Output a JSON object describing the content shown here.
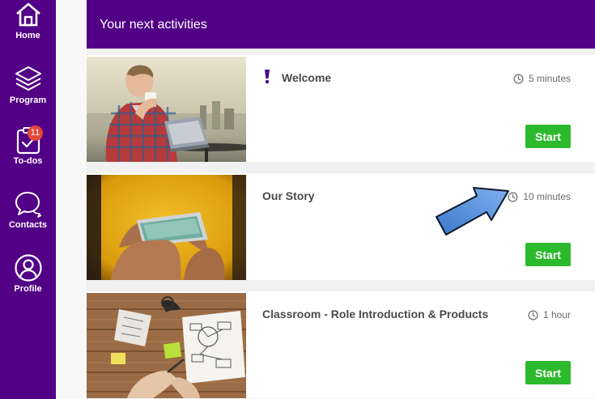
{
  "sidebar": {
    "items": [
      {
        "label": "Home",
        "icon": "home-icon"
      },
      {
        "label": "Program",
        "icon": "layers-icon"
      },
      {
        "label": "To-dos",
        "icon": "clipboard-check-icon",
        "badge": "11"
      },
      {
        "label": "Contacts",
        "icon": "chat-bubbles-icon"
      },
      {
        "label": "Profile",
        "icon": "user-circle-icon"
      }
    ]
  },
  "header": {
    "title": "Your next activities"
  },
  "activities": [
    {
      "title": "Welcome",
      "duration": "5 minutes",
      "start_label": "Start",
      "image": "man-drinking-coffee-photo",
      "flag_icon": "exclamation-icon"
    },
    {
      "title": "Our Story",
      "duration": "10 minutes",
      "start_label": "Start",
      "image": "hands-holding-phone-photo"
    },
    {
      "title": "Classroom - Role Introduction & Products",
      "duration": "1 hour",
      "start_label": "Start",
      "image": "hands-drawing-diagram-photo"
    }
  ],
  "colors": {
    "brand": "#520085",
    "start": "#2db92d",
    "badge": "#e4483d",
    "arrow": "#4a86d8"
  }
}
